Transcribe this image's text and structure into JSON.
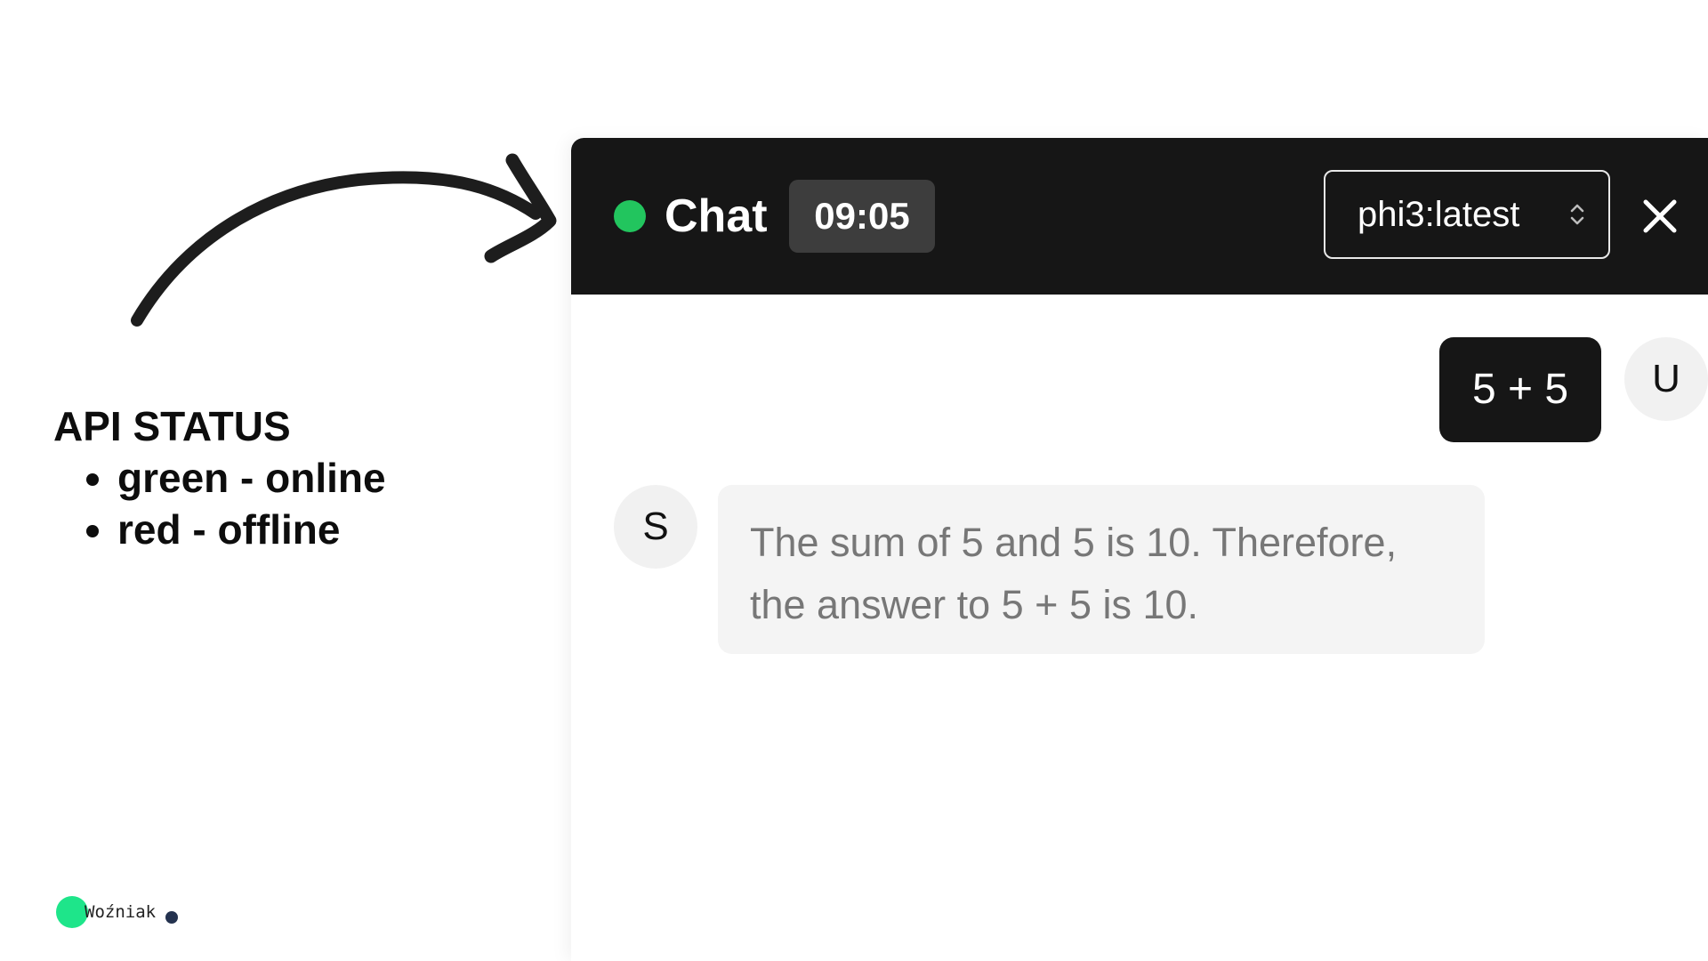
{
  "annotation": {
    "heading": "API STATUS",
    "items": [
      "green -  online",
      "red - offline"
    ]
  },
  "brand": {
    "name": "Woźniak"
  },
  "chat": {
    "title": "Chat",
    "time": "09:05",
    "status": "online",
    "model": {
      "selected": "phi3:latest"
    },
    "icons": {
      "status": "status-dot-icon",
      "model_selector": "chevron-updown-icon",
      "close": "close-icon"
    },
    "messages": [
      {
        "role": "user",
        "avatar": "U",
        "text": "5 + 5"
      },
      {
        "role": "system",
        "avatar": "S",
        "text": "The sum of 5 and 5 is 10. Therefore, the answer to 5 + 5 is 10."
      }
    ]
  },
  "colors": {
    "online": "#22c55e",
    "header_bg": "#161616",
    "assistant_bg": "#f4f4f4",
    "brand_accent": "#1ee58a"
  }
}
